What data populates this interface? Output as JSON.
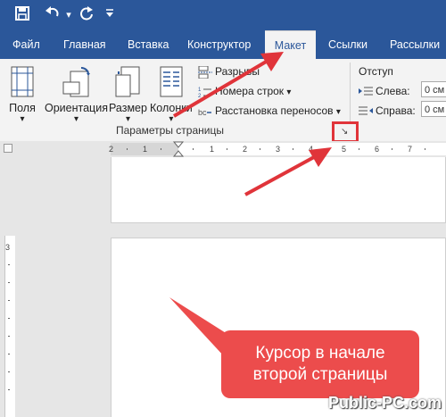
{
  "quick_access": {
    "icons": [
      "save-icon",
      "undo-icon",
      "redo-icon",
      "customize-icon"
    ],
    "customize_glyph": "▾"
  },
  "tabs": [
    "Файл",
    "Главная",
    "Вставка",
    "Конструктор",
    "Макет",
    "Ссылки",
    "Рассылки"
  ],
  "active_tab": "Макет",
  "ribbon": {
    "margins_label": "Поля",
    "orientation_label": "Ориентация",
    "size_label": "Размер",
    "columns_label": "Колонки",
    "breaks_label": "Разрывы",
    "line_numbers_label": "Номера строк",
    "hyphenation_label": "Расстановка переносов",
    "dropdown_glyph": "▾",
    "group_label": "Параметры страницы",
    "launcher_glyph": "↘",
    "indent_title": "Отступ",
    "left_label": "Слева:",
    "right_label": "Справа:",
    "left_value": "0 см",
    "right_value": "0 см"
  },
  "ruler": {
    "labels": [
      "2",
      "1",
      "1",
      "2",
      "3",
      "4",
      "5",
      "6",
      "7"
    ],
    "left_vertical_label": "3"
  },
  "callout": {
    "line1": "Курсор в начале",
    "line2": "второй страницы"
  },
  "watermark": "Public-PC.com",
  "colors": {
    "brand": "#2b579a",
    "highlight": "#e0343a",
    "callout": "#ec4c4c"
  }
}
